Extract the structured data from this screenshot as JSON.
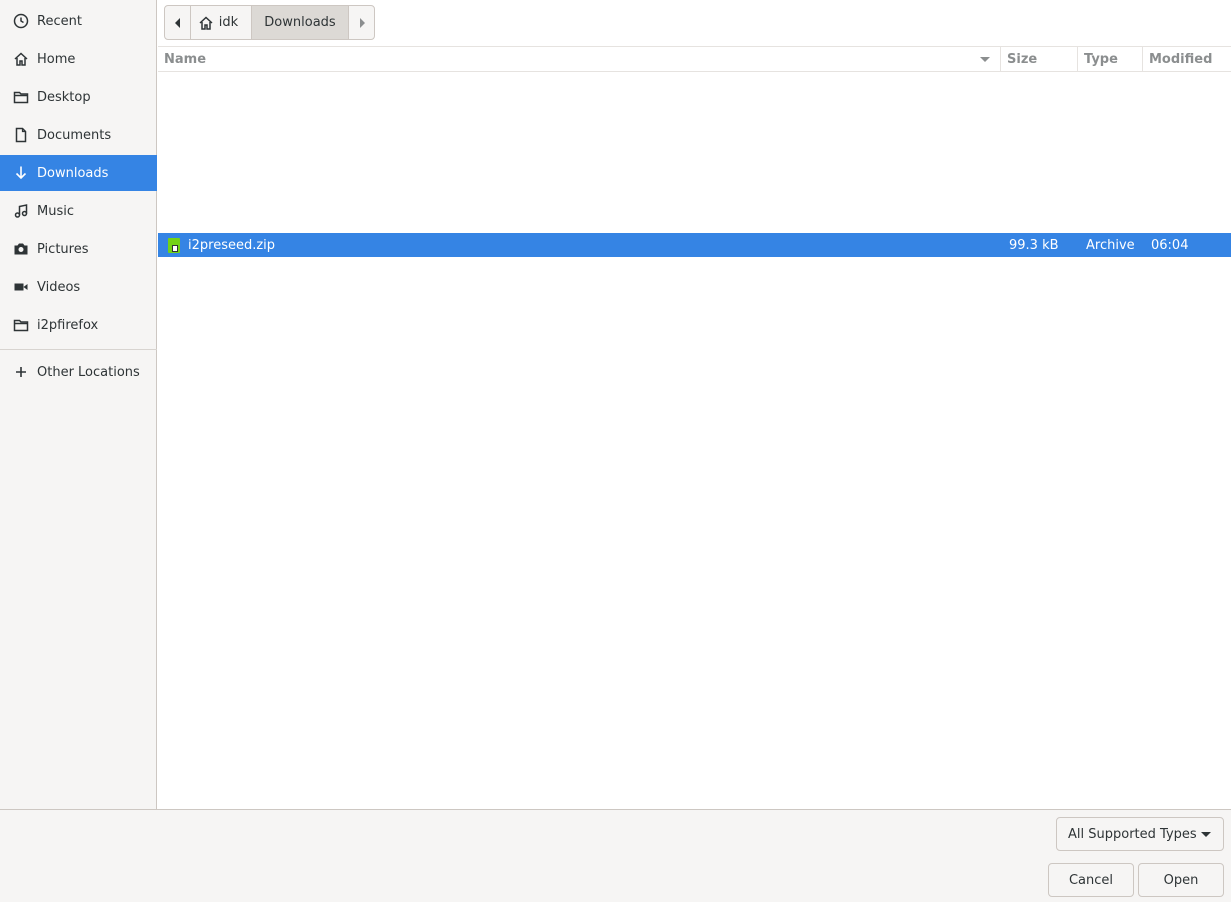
{
  "sidebar": {
    "items": [
      {
        "label": "Recent",
        "icon": "clock-icon"
      },
      {
        "label": "Home",
        "icon": "home-icon"
      },
      {
        "label": "Desktop",
        "icon": "folder-icon"
      },
      {
        "label": "Documents",
        "icon": "document-icon"
      },
      {
        "label": "Downloads",
        "icon": "download-icon",
        "active": true
      },
      {
        "label": "Music",
        "icon": "music-icon"
      },
      {
        "label": "Pictures",
        "icon": "camera-icon"
      },
      {
        "label": "Videos",
        "icon": "video-icon"
      },
      {
        "label": "i2pfirefox",
        "icon": "folder-icon"
      },
      {
        "label": "Other Locations",
        "icon": "plus-icon"
      }
    ]
  },
  "pathbar": {
    "home_label": "idk",
    "current_label": "Downloads"
  },
  "filelist": {
    "columns": {
      "name": "Name",
      "size": "Size",
      "type": "Type",
      "modified": "Modified"
    },
    "rows": [
      {
        "name": "i2preseed.zip",
        "size": "99.3 kB",
        "type": "Archive",
        "modified": "06:04",
        "selected": true
      }
    ]
  },
  "footer": {
    "filter_label": "All Supported Types",
    "cancel_label": "Cancel",
    "open_label": "Open"
  },
  "colors": {
    "accent": "#3584e4",
    "sidebar_bg": "#f6f5f4",
    "text": "#2e3436"
  }
}
